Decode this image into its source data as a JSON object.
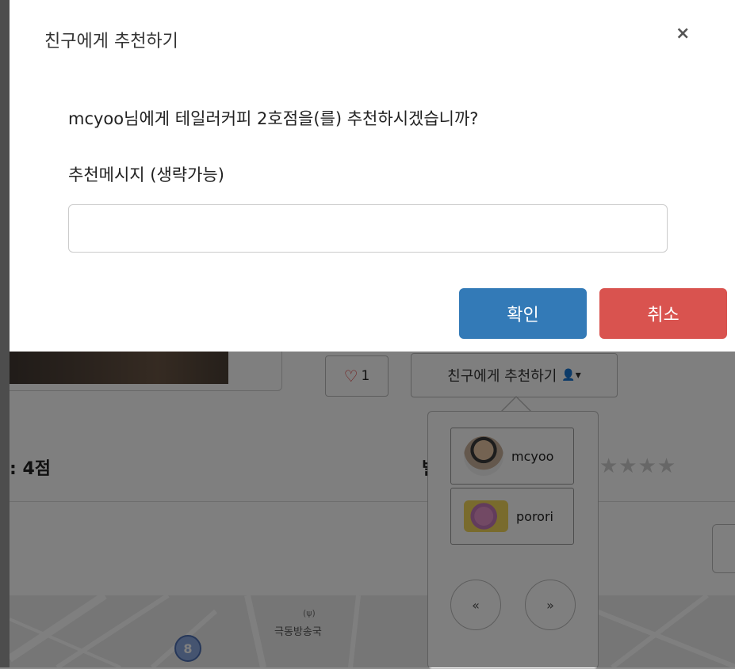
{
  "modal": {
    "title": "친구에게 추천하기",
    "close_symbol": "×",
    "question": "mcyoo님에게 테일러커피 2호점을(를) 추천하시겠습니까?",
    "message_label": "추천메시지 (생략가능)",
    "message_value": "",
    "message_placeholder": "",
    "confirm_label": "확인",
    "cancel_label": "취소"
  },
  "background": {
    "like_count": "1",
    "recommend_button_label": "친구에게 추천하기",
    "score_text": ": 4점",
    "partial_label": "별",
    "stars": "★★★★",
    "map_label": "극동방송국",
    "map_marker": "8",
    "broadcast_symbol": "(ψ)"
  },
  "friend_dropdown": {
    "friends": [
      {
        "name": "mcyoo"
      },
      {
        "name": "porori"
      }
    ],
    "prev_label": "«",
    "next_label": "»"
  },
  "colors": {
    "confirm": "#337ab7",
    "cancel": "#d9534f",
    "heart": "#e03131"
  }
}
